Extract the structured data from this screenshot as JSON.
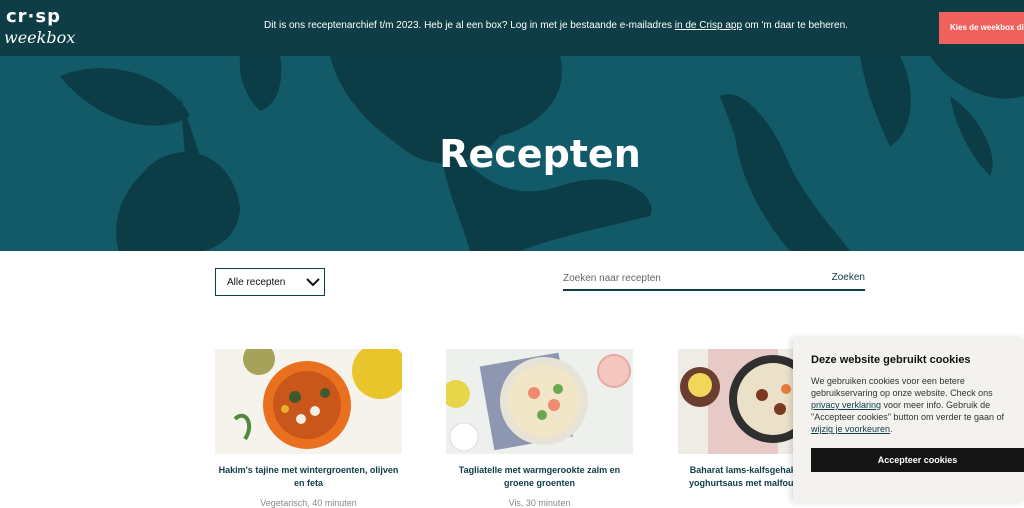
{
  "topbar": {
    "logo_top": "cr·sp",
    "logo_bottom": "weekbox",
    "notice_before": "Dit is ons receptenarchief t/m 2023. Heb je al een box? Log in met je bestaande e-mailadres ",
    "notice_link": "in de Crisp app",
    "notice_after": " om 'm daar te beheren.",
    "cta_label": "Kies de weekbox die"
  },
  "hero": {
    "title": "Recepten"
  },
  "filters": {
    "dropdown_selected": "Alle recepten",
    "search_placeholder": "Zoeken naar recepten",
    "search_button": "Zoeken"
  },
  "recipes": [
    {
      "title": "Hakim's tajine met wintergroenten, olijven en feta",
      "meta": "Vegetarisch, 40 minuten"
    },
    {
      "title": "Tagliatelle met warmgerookte zalm en groene groenten",
      "meta": "Vis, 30 minuten"
    },
    {
      "title": "Baharat lams-kalfsgehaktballetjes met yoghurtsaus met malfouf en couscous",
      "meta": ""
    }
  ],
  "cookie": {
    "title": "Deze website gebruikt cookies",
    "text_1": "We gebruiken cookies voor een betere gebruikservaring op onze website. Check ons ",
    "privacy_link": "privacy verklaring",
    "text_2": " voor meer info. Gebruik de \"Accepteer cookies\" button om verder te gaan of ",
    "prefs_link": "wijzig je voorkeuren",
    "text_3": ".",
    "accept_label": "Accepteer cookies"
  },
  "colors": {
    "brand_dark": "#0e3d46",
    "hero_teal": "#135a69",
    "cta": "#f0615d"
  }
}
